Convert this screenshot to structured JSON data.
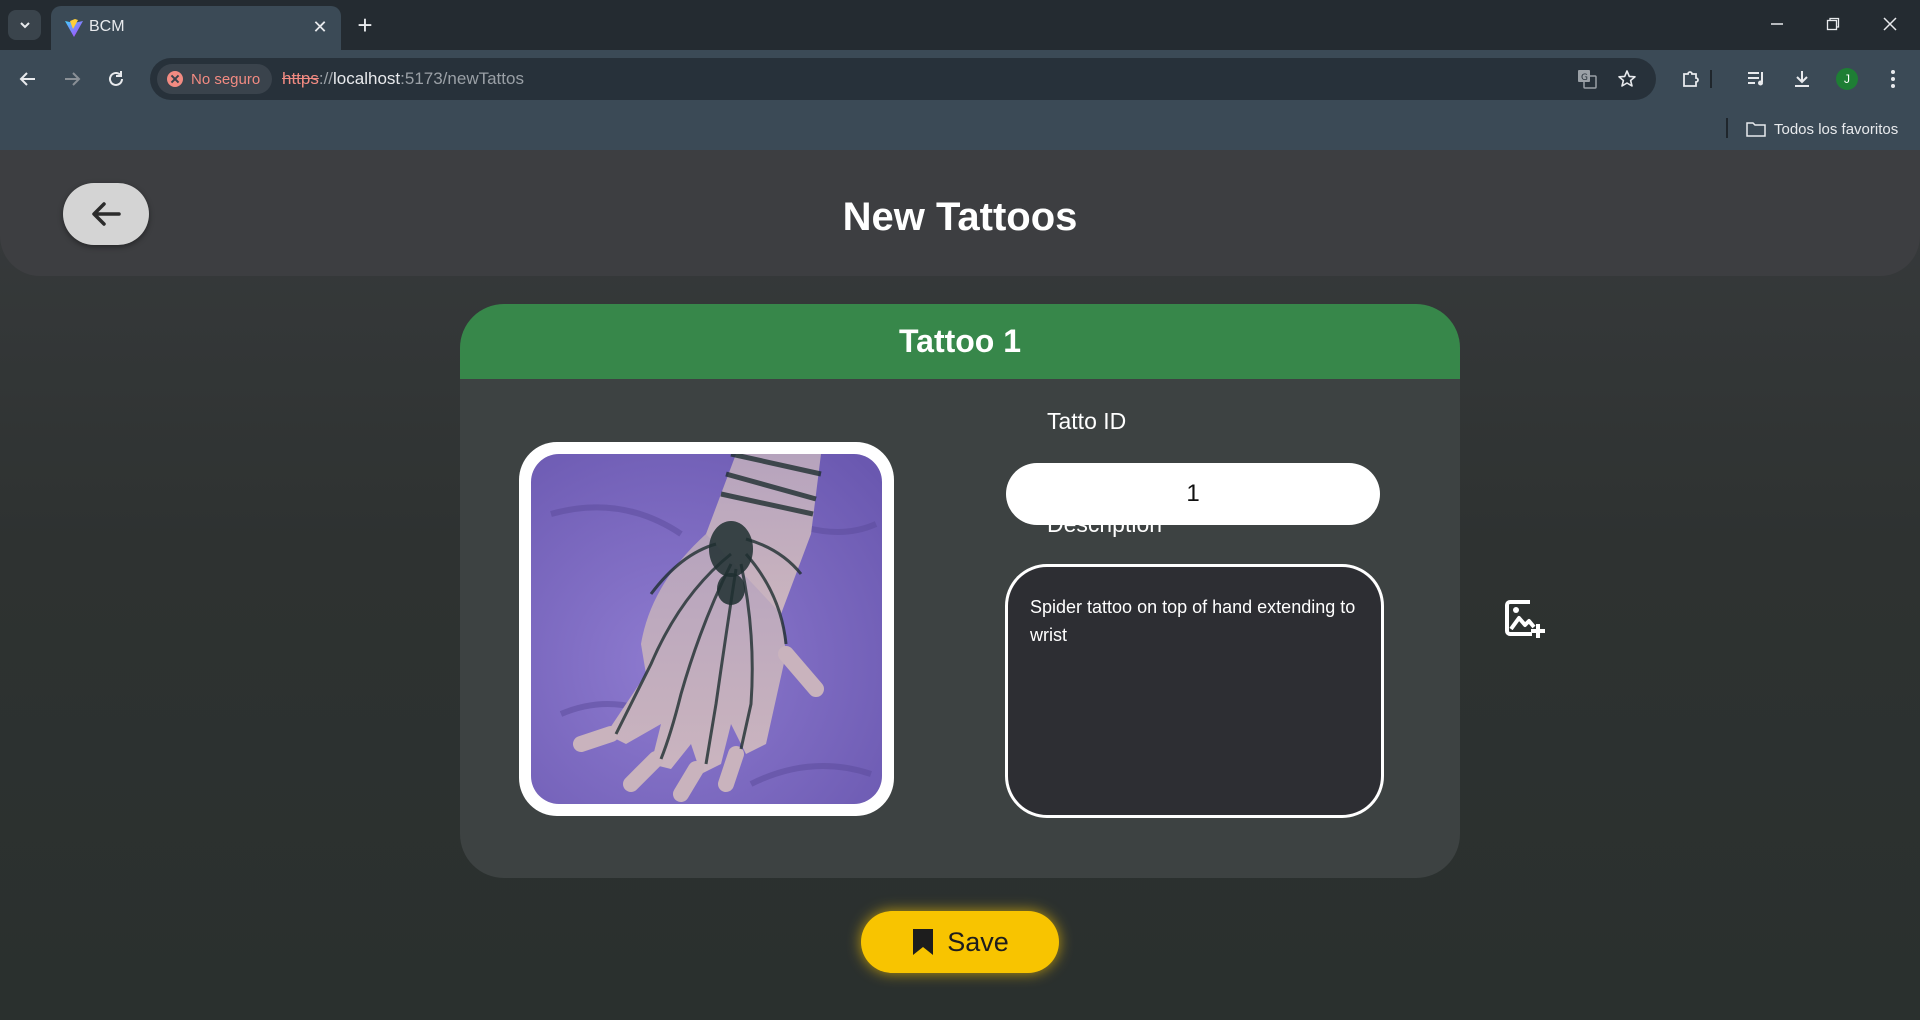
{
  "browser": {
    "tab_title": "BCM",
    "security_label": "No seguro",
    "url_scheme": "https",
    "url_sep": "://",
    "url_host": "localhost",
    "url_rest": ":5173/newTattos",
    "bookmarks_label": "Todos los favoritos",
    "profile_initial": "J"
  },
  "page": {
    "title": "New Tattoos"
  },
  "card": {
    "title": "Tattoo 1",
    "id_label": "Tatto ID",
    "id_value": "1",
    "description_label": "Description",
    "description_value": "Spider tattoo on top of hand extending to wrist"
  },
  "actions": {
    "save_label": "Save"
  },
  "colors": {
    "header_green": "#37874a",
    "save_yellow": "#f8c400"
  }
}
